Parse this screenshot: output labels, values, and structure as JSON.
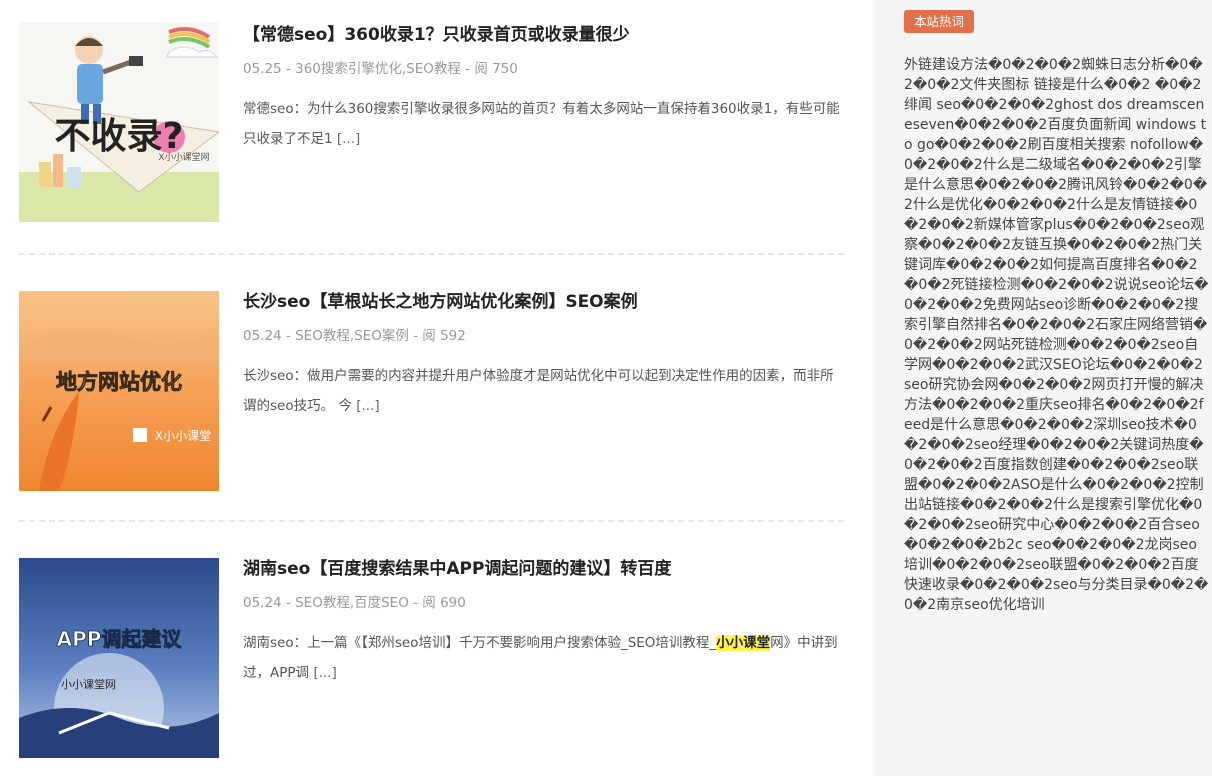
{
  "posts": [
    {
      "title": "【常德seo】360收录1？只收录首页或收录量很少",
      "meta": "05.25 - 360搜索引擎优化,SEO教程 - 阅 750",
      "excerpt": "常德seo：为什么360搜索引擎收录很多网站的首页？有着太多网站一直保持着360收录1，有些可能只收录了不足1",
      "more": "[...]",
      "thumb_text": "不收录?",
      "thumb_brand": "X小小课堂网"
    },
    {
      "title": "长沙seo【草根站长之地方网站优化案例】SEO案例",
      "meta": "05.24 - SEO教程,SEO案例 - 阅 592",
      "excerpt": "长沙seo：做用户需要的内容并提升用户体验度才是网站优化中可以起到决定性作用的因素，而非所谓的seo技巧。 今",
      "more": "[...]",
      "thumb_text": "地方网站优化",
      "thumb_brand": "X小小课堂"
    },
    {
      "title": "湖南seo【百度搜索结果中APP调起问题的建议】转百度",
      "meta": "05.24 - SEO教程,百度SEO - 阅 690",
      "excerpt_before": "湖南seo：上一篇《【郑州seo培训】千万不要影响用户搜索体验_SEO培训教程_",
      "excerpt_highlight": "小小课堂",
      "excerpt_after": "网》中讲到过，APP调",
      "more": "[...]",
      "thumb_text": "APP调起建议",
      "thumb_brand": "小小课堂网"
    }
  ],
  "sidebar": {
    "badge": "本站热词",
    "hot_text": "外链建设方法�0�2�0�2蜘蛛日志分析�0�2�0�2文件夹图标 链接是什么�0�2 �0�2绯闻 seo�0�2�0�2ghost dos dreamsceneseven�0�2�0�2百度负面新闻 windows to go�0�2�0�2刷百度相关搜索 nofollow�0�2�0�2什么是二级域名�0�2�0�2引擎是什么意思�0�2�0�2腾讯风铃�0�2�0�2什么是优化�0�2�0�2什么是友情链接�0�2�0�2新媒体管家plus�0�2�0�2seo观察�0�2�0�2友链互换�0�2�0�2热门关键词库�0�2�0�2如何提高百度排名�0�2�0�2死链接检测�0�2�0�2说说seo论坛�0�2�0�2免费网站seo诊断�0�2�0�2搜索引擎自然排名�0�2�0�2石家庄网络营销�0�2�0�2网站死链检测�0�2�0�2seo自学网�0�2�0�2武汉SEO论坛�0�2�0�2seo研究协会网�0�2�0�2网页打开慢的解决方法�0�2�0�2重庆seo排名�0�2�0�2feed是什么意思�0�2�0�2深圳seo技术�0�2�0�2seo经理�0�2�0�2关键词热度�0�2�0�2百度指数创建�0�2�0�2seo联盟�0�2�0�2ASO是什么�0�2�0�2控制出站链接�0�2�0�2什么是搜索引擎优化�0�2�0�2seo研究中心�0�2�0�2百合seo�0�2�0�2b2c seo�0�2�0�2龙岗seo培训�0�2�0�2seo联盟�0�2�0�2百度快速收录�0�2�0�2seo与分类目录�0�2�0�2南京seo优化培训"
  }
}
